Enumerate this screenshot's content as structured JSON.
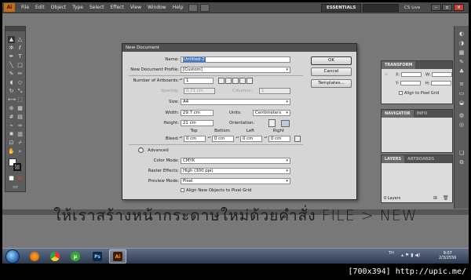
{
  "menubar": {
    "logo": "Ai",
    "items": [
      "File",
      "Edit",
      "Object",
      "Type",
      "Select",
      "Effect",
      "View",
      "Window",
      "Help"
    ],
    "workspace": "ESSENTIALS",
    "cs_live": "CS Live"
  },
  "dialog": {
    "title": "New Document",
    "name_label": "Name:",
    "name_value": "Untitled-2",
    "profile_label": "New Document Profile:",
    "profile_value": "[Custom]",
    "artboards_label": "Number of Artboards:",
    "artboards_value": "1",
    "spacing_label": "Spacing:",
    "spacing_value": "0.71 cm",
    "columns_label": "Columns:",
    "columns_value": "1",
    "size_label": "Size:",
    "size_value": "A4",
    "width_label": "Width:",
    "width_value": "29.7 cm",
    "units_label": "Units:",
    "units_value": "Centimeters",
    "height_label": "Height:",
    "height_value": "21 cm",
    "orientation_label": "Orientation:",
    "bleed_label": "Bleed:",
    "bleed_headers": [
      "Top",
      "Bottom",
      "Left",
      "Right"
    ],
    "bleed_values": [
      "0 cm",
      "0 cm",
      "0 cm",
      "0 cm"
    ],
    "advanced_label": "Advanced",
    "color_mode_label": "Color Mode:",
    "color_mode_value": "CMYK",
    "raster_label": "Raster Effects:",
    "raster_value": "High (300 ppi)",
    "preview_label": "Preview Mode:",
    "preview_value": "Pixel",
    "align_checkbox_label": "Align New Objects to Pixel Grid",
    "ok_label": "OK",
    "cancel_label": "Cancel",
    "templates_label": "Templates..."
  },
  "doc_info": {
    "line1": "Color Mode:CMYK",
    "line2": "PPI:300",
    "line3": "Align to Pixel Grid:No"
  },
  "panels": {
    "transform_tab": "TRANSFORM",
    "align_pixel_grid": "Align to Pixel Grid",
    "navigator_tab": "NAVIGATOR",
    "info_tab": "INFO",
    "layers_tab": "LAYERS",
    "artboards_tab": "ARTBOARDS",
    "layers_count": "0 Layers",
    "transform_labels": [
      "X:",
      "W:",
      "Y:",
      "H:"
    ]
  },
  "caption": "ให้เราสร้างหน้ากระดาษใหม่ด้วยคำสั่ง FILE > NEW",
  "taskbar": {
    "lang": "TH",
    "time": "9:07",
    "date": "2/3/2556"
  },
  "watermark": "[700x394] http://upic.me/"
}
